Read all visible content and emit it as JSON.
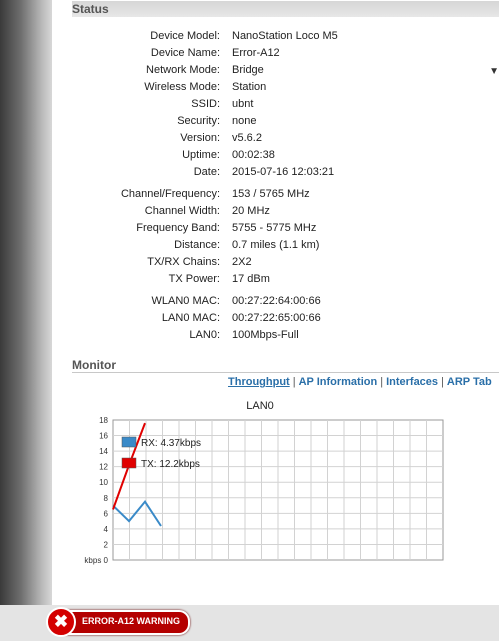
{
  "status": {
    "title": "Status",
    "rows": [
      {
        "key": "Device Model:",
        "value": "NanoStation Loco M5"
      },
      {
        "key": "Device Name:",
        "value": "Error-A12"
      },
      {
        "key": "Network Mode:",
        "value": "Bridge"
      },
      {
        "key": "Wireless Mode:",
        "value": "Station"
      },
      {
        "key": "SSID:",
        "value": "ubnt"
      },
      {
        "key": "Security:",
        "value": "none"
      },
      {
        "key": "Version:",
        "value": "v5.6.2"
      },
      {
        "key": "Uptime:",
        "value": "00:02:38"
      },
      {
        "key": "Date:",
        "value": "2015-07-16 12:03:21"
      },
      {
        "key": "Channel/Frequency:",
        "value": "153 / 5765 MHz"
      },
      {
        "key": "Channel Width:",
        "value": "20 MHz"
      },
      {
        "key": "Frequency Band:",
        "value": "5755 - 5775 MHz"
      },
      {
        "key": "Distance:",
        "value": "0.7 miles (1.1 km)"
      },
      {
        "key": "TX/RX Chains:",
        "value": "2X2"
      },
      {
        "key": "TX Power:",
        "value": "17 dBm"
      },
      {
        "key": "WLAN0 MAC:",
        "value": "00:27:22:64:00:66"
      },
      {
        "key": "LAN0 MAC:",
        "value": "00:27:22:65:00:66"
      },
      {
        "key": "LAN0:",
        "value": "100Mbps-Full"
      }
    ]
  },
  "monitor": {
    "title": "Monitor",
    "tabs": [
      {
        "label": "Throughput",
        "active": true
      },
      {
        "label": "AP Information",
        "active": false
      },
      {
        "label": "Interfaces",
        "active": false
      },
      {
        "label": "ARP Tab",
        "active": false
      }
    ]
  },
  "chart_data": {
    "type": "line",
    "title": "LAN0",
    "ylabel": "kbps",
    "ylim": [
      0,
      18
    ],
    "yticks": [
      "18",
      "16",
      "14",
      "12",
      "10",
      "8",
      "6",
      "4",
      "2",
      "kbps 0"
    ],
    "series": [
      {
        "name": "RX: 4.37kbps",
        "color": "#3a8ac8",
        "values": [
          7,
          5,
          7.5,
          4.37
        ]
      },
      {
        "name": "TX: 12.2kbps",
        "color": "#e00000",
        "values": [
          6.5,
          12.2,
          17.6
        ]
      }
    ],
    "grid": true,
    "legend_position": "top-left"
  },
  "warning": {
    "label": "ERROR-A12 WARNING"
  }
}
